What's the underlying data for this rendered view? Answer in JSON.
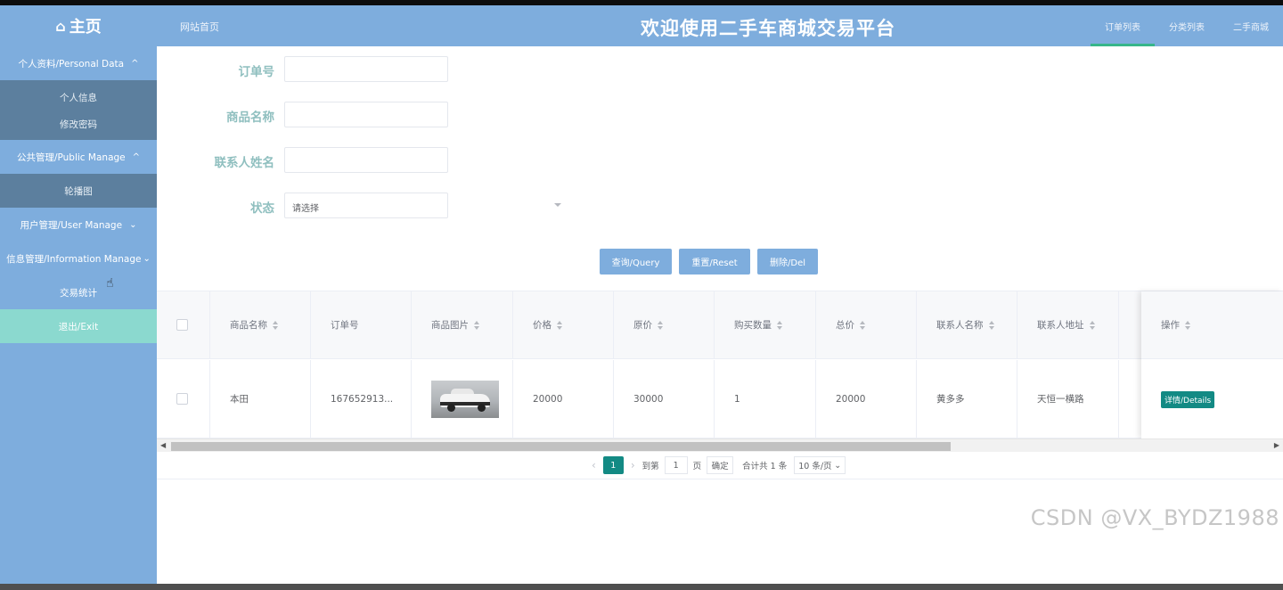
{
  "header": {
    "home_label": "主页",
    "site_home_link": "网站首页",
    "title": "欢迎使用二手车商城交易平台",
    "nav": [
      "订单列表",
      "分类列表",
      "二手商城"
    ]
  },
  "sidebar": {
    "groups": [
      {
        "label": "个人资料/Personal Data",
        "chevron": "^",
        "subitems": [
          "个人信息",
          "修改密码"
        ]
      },
      {
        "label": "公共管理/Public Manage",
        "chevron": "^",
        "subitems": [
          "轮播图"
        ]
      },
      {
        "label": "用户管理/User Manage",
        "chevron": "v",
        "subitems": []
      },
      {
        "label": "信息管理/Information Manage",
        "chevron": "v",
        "subitems": []
      },
      {
        "label": "交易统计",
        "chevron": "",
        "subitems": []
      }
    ],
    "exit_label": "退出/Exit"
  },
  "search_form": {
    "order_no_label": "订单号",
    "product_name_label": "商品名称",
    "contact_name_label": "联系人姓名",
    "status_label": "状态",
    "status_placeholder": "请选择"
  },
  "buttons": {
    "query": "查询/Query",
    "reset": "重置/Reset",
    "delete": "删除/Del"
  },
  "table": {
    "columns": [
      "商品名称",
      "订单号",
      "商品图片",
      "价格",
      "原价",
      "购买数量",
      "总价",
      "联系人名称",
      "联系人地址",
      "操作"
    ],
    "rows": [
      {
        "product_name": "本田",
        "order_no": "167652913...",
        "image": "car-photo",
        "price": "20000",
        "original_price": "30000",
        "quantity": "1",
        "total": "20000",
        "contact_name": "黄多多",
        "contact_address": "天恒一横路",
        "action": "详情/Details"
      }
    ]
  },
  "pagination": {
    "current_page": "1",
    "goto_label": "到第",
    "goto_value": "1",
    "page_unit": "页",
    "confirm": "确定",
    "total_text": "合计共 1 条",
    "page_size": "10 条/页"
  },
  "watermark": "CSDN @VX_BYDZ1988",
  "colors": {
    "header_bg": "#7eaddd",
    "submenu_bg": "#5c7f9e",
    "exit_bg": "#8bd9cf",
    "accent": "#138a84",
    "label_color": "#8fbfbf"
  }
}
